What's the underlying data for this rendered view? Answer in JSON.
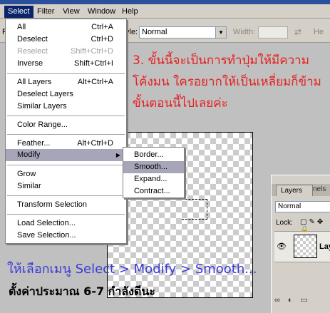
{
  "menubar": {
    "items": [
      {
        "label": "Select",
        "active": true
      },
      {
        "label": "Filter",
        "active": false
      },
      {
        "label": "View",
        "active": false
      },
      {
        "label": "Window",
        "active": false
      },
      {
        "label": "Help",
        "active": false
      }
    ]
  },
  "options": {
    "prefix": "F",
    "style_label": "yle:",
    "style_value": "Normal",
    "width_label": "Width:",
    "height_label": "He"
  },
  "select_menu": {
    "items": [
      {
        "label": "All",
        "shortcut": "Ctrl+A",
        "disabled": false
      },
      {
        "label": "Deselect",
        "shortcut": "Ctrl+D",
        "disabled": false
      },
      {
        "label": "Reselect",
        "shortcut": "Shift+Ctrl+D",
        "disabled": true
      },
      {
        "label": "Inverse",
        "shortcut": "Shift+Ctrl+I",
        "disabled": false
      },
      {
        "label": "All Layers",
        "shortcut": "Alt+Ctrl+A",
        "disabled": false
      },
      {
        "label": "Deselect Layers",
        "shortcut": "",
        "disabled": false
      },
      {
        "label": "Similar Layers",
        "shortcut": "",
        "disabled": false
      },
      {
        "label": "Color Range...",
        "shortcut": "",
        "disabled": false
      },
      {
        "label": "Feather...",
        "shortcut": "Alt+Ctrl+D",
        "disabled": false
      },
      {
        "label": "Modify",
        "shortcut": "",
        "disabled": false,
        "submenu": true
      },
      {
        "label": "Grow",
        "shortcut": "",
        "disabled": false
      },
      {
        "label": "Similar",
        "shortcut": "",
        "disabled": false
      },
      {
        "label": "Transform Selection",
        "shortcut": "",
        "disabled": false
      },
      {
        "label": "Load Selection...",
        "shortcut": "",
        "disabled": false
      },
      {
        "label": "Save Selection...",
        "shortcut": "",
        "disabled": false
      }
    ]
  },
  "modify_submenu": {
    "items": [
      {
        "label": "Border..."
      },
      {
        "label": "Smooth..."
      },
      {
        "label": "Expand..."
      },
      {
        "label": "Contract..."
      }
    ]
  },
  "layers_panel": {
    "tab_active": "Layers",
    "tab_inactive": "nels",
    "blend_mode": "Normal",
    "lock_label": "Lock:",
    "layer_name": "Lay"
  },
  "annotations": {
    "step3_line1": "3. ขั้นนี้จะเป็นการทำปุ่มให้มีความ",
    "step3_line2": "โค้งมน ใครอยากให้เป็นเหลี่ยมก็ข้าม",
    "step3_line3": "ขั้นตอนนี้ไปเลยค่ะ",
    "instruction": "ให้เลือกเมนู Select > Modify > Smooth...",
    "hint": "ตั้งค่าประมาณ 6-7 กำลังดีนะ"
  },
  "icons": {
    "submenu_arrow": "chevron-right-icon",
    "dropdown_arrow": "chevron-down-icon",
    "eye": "eye-icon",
    "swap": "swap-icon"
  }
}
